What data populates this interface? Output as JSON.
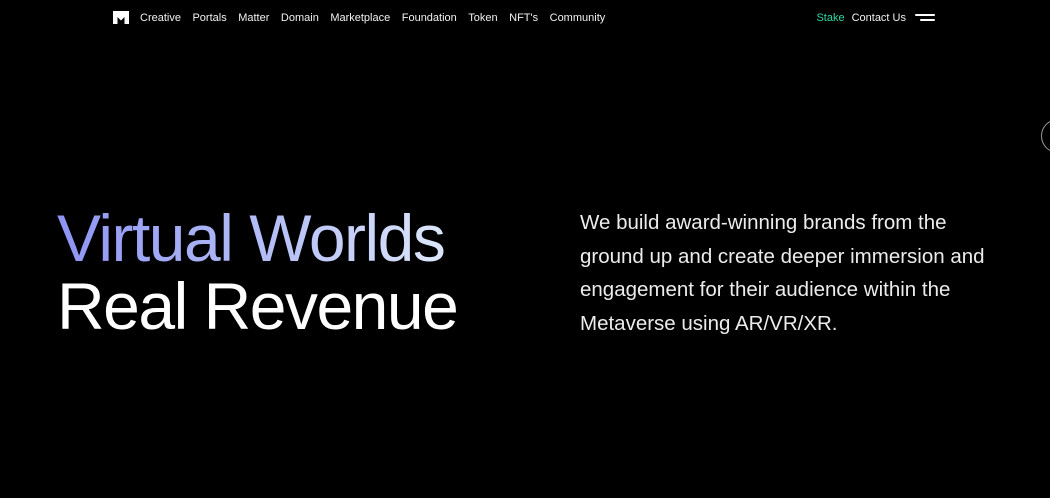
{
  "nav": {
    "logo_icon": "m-logo-icon",
    "links": [
      "Creative",
      "Portals",
      "Matter",
      "Domain",
      "Marketplace",
      "Foundation",
      "Token",
      "NFT's",
      "Community"
    ],
    "stake_label": "Stake",
    "contact_label": "Contact Us",
    "menu_icon": "hamburger-menu-icon"
  },
  "hero": {
    "title_line1": "Virtual Worlds",
    "title_line2": "Real Revenue",
    "description": "We build award-winning brands from the ground up and create deeper immersion and engagement for their audience within the Metaverse using AR/VR/XR."
  },
  "colors": {
    "background": "#000000",
    "stake_accent": "#2fd8a6",
    "title_gradient_start": "#8f94f4",
    "title_gradient_end": "#dfe9fa"
  }
}
